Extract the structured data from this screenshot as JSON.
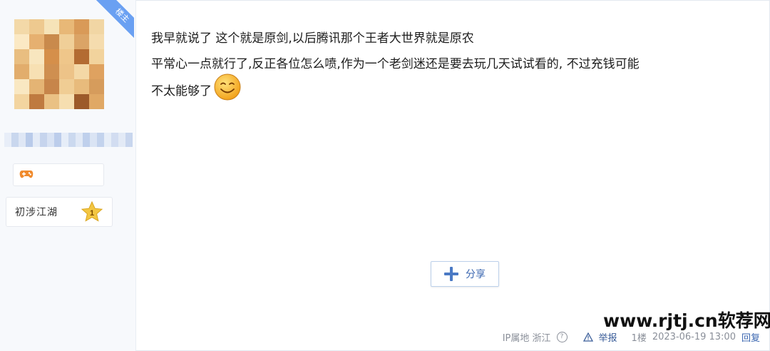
{
  "author": {
    "corner_badge": "楼主",
    "title": "初涉江湖",
    "level_number": "1"
  },
  "post": {
    "lines": [
      "我早就说了 这个就是原剑,以后腾讯那个王者大世界就是原农",
      "平常心一点就行了,反正各位怎么喷,作为一个老剑迷还是要去玩几天试试看的, 不过充钱可能",
      "不太能够了"
    ]
  },
  "actions": {
    "share_label": "分享"
  },
  "footer": {
    "ip_location": "IP属地 浙江",
    "help": "?",
    "report": "举报",
    "floor": "1楼",
    "timestamp": "2023-06-19 13:00",
    "reply": "回复"
  },
  "watermark": "www.rjtj.cn软荐网",
  "colors": {
    "accent_blue": "#3a66b0",
    "badge_blue": "#6aa0f2",
    "gamepad_orange": "#f08a2c",
    "star_gold": "#f3c642"
  }
}
